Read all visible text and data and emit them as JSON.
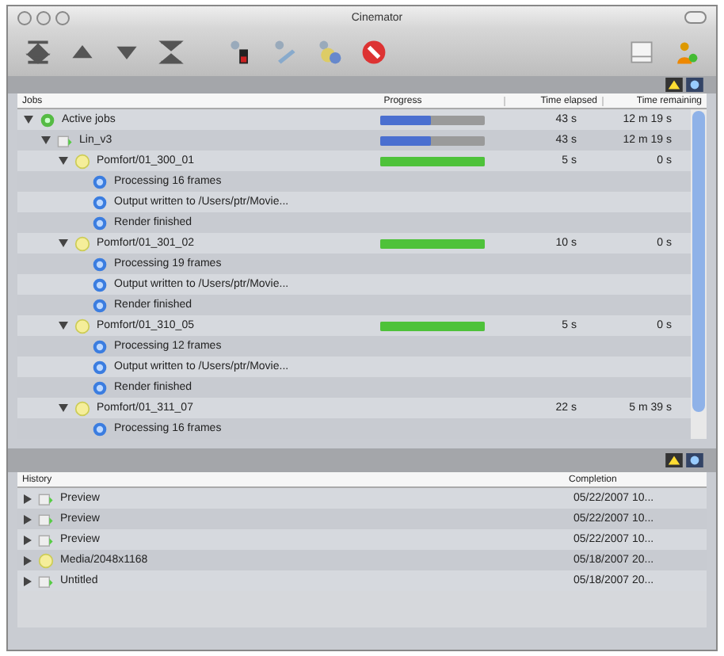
{
  "window": {
    "title": "Cinemator"
  },
  "jobs": {
    "columns": [
      "Jobs",
      "Progress",
      "Time elapsed",
      "Time remaining"
    ],
    "rows": [
      {
        "kind": "group",
        "label": "Active jobs",
        "expanded": true,
        "progress": {
          "level": 0.48,
          "color": "#4a6fd0"
        },
        "elapsed": "43 s",
        "remaining": "12 m 19 s",
        "children": [
          {
            "kind": "project",
            "label": "Lin_v3",
            "expanded": true,
            "progress": {
              "level": 0.48,
              "color": "#4a6fd0"
            },
            "elapsed": "43 s",
            "remaining": "12 m 19 s",
            "children": [
              {
                "kind": "job",
                "label": "Pomfort/01_300_01",
                "expanded": true,
                "progress": {
                  "level": 1,
                  "color": "#4ec23a"
                },
                "elapsed": "5 s",
                "remaining": "0 s",
                "children": [
                  {
                    "kind": "message",
                    "label": "Processing 16 frames"
                  },
                  {
                    "kind": "message",
                    "label": "Output written to /Users/ptr/Movie..."
                  },
                  {
                    "kind": "message",
                    "label": "Render finished"
                  }
                ]
              },
              {
                "kind": "job",
                "label": "Pomfort/01_301_02",
                "expanded": true,
                "progress": {
                  "level": 1,
                  "color": "#4ec23a"
                },
                "elapsed": "10 s",
                "remaining": "0 s",
                "children": [
                  {
                    "kind": "message",
                    "label": "Processing 19 frames"
                  },
                  {
                    "kind": "message",
                    "label": "Output written to /Users/ptr/Movie..."
                  },
                  {
                    "kind": "message",
                    "label": "Render finished"
                  }
                ]
              },
              {
                "kind": "job",
                "label": "Pomfort/01_310_05",
                "expanded": true,
                "progress": {
                  "level": 1,
                  "color": "#4ec23a"
                },
                "elapsed": "5 s",
                "remaining": "0 s",
                "children": [
                  {
                    "kind": "message",
                    "label": "Processing 12 frames"
                  },
                  {
                    "kind": "message",
                    "label": "Output written to /Users/ptr/Movie..."
                  },
                  {
                    "kind": "message",
                    "label": "Render finished"
                  }
                ]
              },
              {
                "kind": "job",
                "label": "Pomfort/01_311_07",
                "expanded": true,
                "elapsed": "22 s",
                "remaining": "5 m 39 s",
                "children": [
                  {
                    "kind": "message",
                    "label": "Processing 16 frames"
                  }
                ]
              }
            ]
          }
        ]
      }
    ]
  },
  "history": {
    "columns": [
      "History",
      "Completion"
    ],
    "rows": [
      {
        "kind": "project",
        "label": "Preview",
        "completion": "05/22/2007 10..."
      },
      {
        "kind": "project",
        "label": "Preview",
        "completion": "05/22/2007 10..."
      },
      {
        "kind": "project",
        "label": "Preview",
        "completion": "05/22/2007 10..."
      },
      {
        "kind": "job",
        "label": "Media/2048x1168",
        "completion": "05/18/2007 20..."
      },
      {
        "kind": "project",
        "label": "Untitled",
        "completion": "05/18/2007 20..."
      }
    ]
  }
}
